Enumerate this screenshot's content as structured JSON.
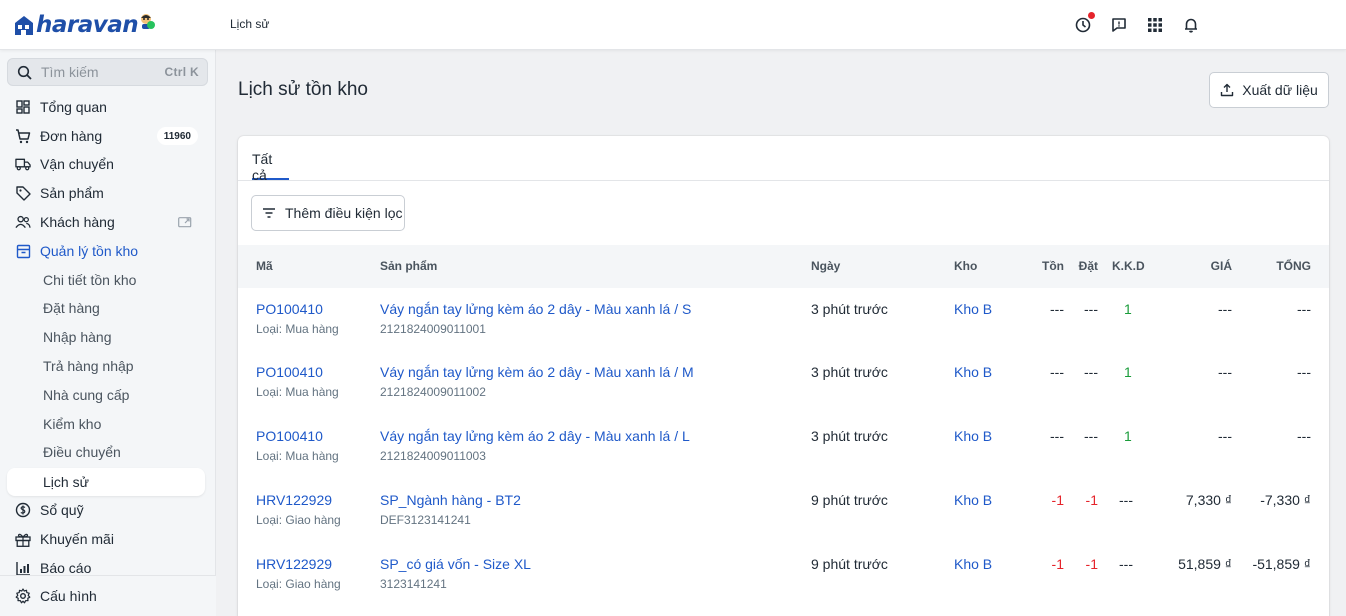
{
  "header": {
    "logo_text": "haravan",
    "breadcrumb": "Lịch sử",
    "icons": [
      "clock-alert-icon",
      "feedback-icon",
      "apps-grid-icon",
      "bell-icon"
    ]
  },
  "sidebar": {
    "search_placeholder": "Tìm kiếm",
    "search_shortcut": "Ctrl K",
    "items": [
      {
        "label": "Tổng quan",
        "icon": "dashboard-icon"
      },
      {
        "label": "Đơn hàng",
        "icon": "cart-icon",
        "badge": "11960"
      },
      {
        "label": "Vận chuyển",
        "icon": "truck-icon"
      },
      {
        "label": "Sản phẩm",
        "icon": "tag-icon"
      },
      {
        "label": "Khách hàng",
        "icon": "users-icon"
      },
      {
        "label": "Quản lý tồn kho",
        "icon": "box-icon"
      }
    ],
    "sub_items": [
      "Chi tiết tồn kho",
      "Đặt hàng",
      "Nhập hàng",
      "Trả hàng nhập",
      "Nhà cung cấp",
      "Kiểm kho",
      "Điều chuyển",
      "Lịch sử"
    ],
    "after_items": [
      {
        "label": "Sổ quỹ",
        "icon": "dollar-icon"
      },
      {
        "label": "Khuyến mãi",
        "icon": "gift-icon"
      },
      {
        "label": "Báo cáo",
        "icon": "chart-icon"
      }
    ],
    "settings_label": "Cấu hình"
  },
  "main": {
    "title": "Lịch sử tồn kho",
    "export_label": "Xuất dữ liệu",
    "tab_label": "Tất cả",
    "filter_label": "Thêm điều kiện lọc",
    "columns": {
      "code": "Mã",
      "product": "Sản phẩm",
      "date": "Ngày",
      "warehouse": "Kho",
      "stock": "Tồn",
      "ordered": "Đặt",
      "kkd": "K.K.D",
      "price": "GIÁ",
      "total": "TỔNG"
    },
    "rows": [
      {
        "code": "PO100410",
        "type": "Loại: Mua hàng",
        "product": "Váy ngắn tay lửng kèm áo 2 dây - Màu xanh lá / S",
        "sku": "2121824009011001",
        "date": "3 phút trước",
        "warehouse": "Kho B",
        "stock": "---",
        "ordered": "---",
        "kkd": "1",
        "price": "---",
        "total": "---"
      },
      {
        "code": "PO100410",
        "type": "Loại: Mua hàng",
        "product": "Váy ngắn tay lửng kèm áo 2 dây - Màu xanh lá / M",
        "sku": "2121824009011002",
        "date": "3 phút trước",
        "warehouse": "Kho B",
        "stock": "---",
        "ordered": "---",
        "kkd": "1",
        "price": "---",
        "total": "---"
      },
      {
        "code": "PO100410",
        "type": "Loại: Mua hàng",
        "product": "Váy ngắn tay lửng kèm áo 2 dây - Màu xanh lá / L",
        "sku": "2121824009011003",
        "date": "3 phút trước",
        "warehouse": "Kho B",
        "stock": "---",
        "ordered": "---",
        "kkd": "1",
        "price": "---",
        "total": "---"
      },
      {
        "code": "HRV122929",
        "type": "Loại: Giao hàng",
        "product": "SP_Ngành hàng - BT2",
        "sku": "DEF3123141241",
        "date": "9 phút trước",
        "warehouse": "Kho B",
        "stock": "-1",
        "ordered": "-1",
        "kkd": "---",
        "price": "7,330 ₫",
        "total": "-7,330 ₫"
      },
      {
        "code": "HRV122929",
        "type": "Loại: Giao hàng",
        "product": "SP_có giá vốn - Size XL",
        "sku": "3123141241",
        "date": "9 phút trước",
        "warehouse": "Kho B",
        "stock": "-1",
        "ordered": "-1",
        "kkd": "---",
        "price": "51,859 ₫",
        "total": "-51,859 ₫"
      }
    ]
  },
  "colors": {
    "accent": "#1f59c9",
    "negative": "#e5242b",
    "positive": "#1a9c3a",
    "status_online": "#27c25e",
    "logo_blue": "#1f4fa8",
    "logo_orange": "#f49a26"
  }
}
